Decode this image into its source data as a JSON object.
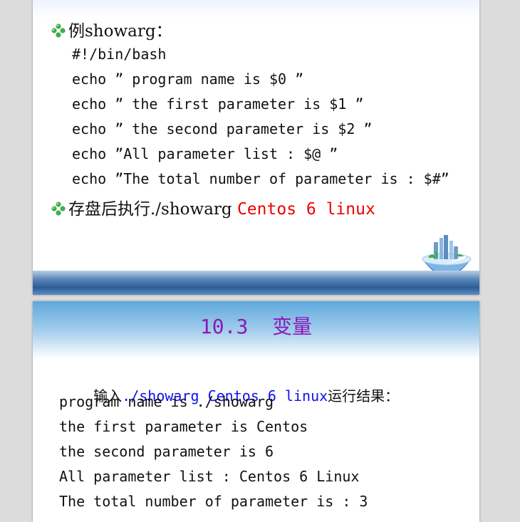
{
  "slide1": {
    "bullet1": {
      "prefix": "例showarg："
    },
    "code_lines": [
      "#!/bin/bash",
      "echo ” program name is $0 ”",
      "echo ” the first parameter is $1 ”",
      "echo ” the second parameter is $2 ”",
      "echo ”All parameter list : $@ ”",
      "echo ”The total number of parameter is : $#”"
    ],
    "bullet2": {
      "prefix": "存盘后执行./showarg ",
      "highlight": "Centos 6 linux"
    }
  },
  "slide2": {
    "title": "10.3  变量",
    "intro": {
      "prefix": "输入",
      "command": "./showarg Centos 6 linux",
      "suffix": "运行结果："
    },
    "output_lines": [
      "program name is ./showarg",
      "the first parameter is Centos",
      "the second parameter is 6",
      "All parameter list : Centos 6 Linux",
      "The total number of parameter is : 3"
    ]
  },
  "colors": {
    "bullet": "#3fae49",
    "highlight_red": "#ee0000",
    "title_purple": "#8a1ab8",
    "command_blue": "#1010ee"
  },
  "icons": [
    "diamond-bullet-icon",
    "globe-city-icon"
  ]
}
